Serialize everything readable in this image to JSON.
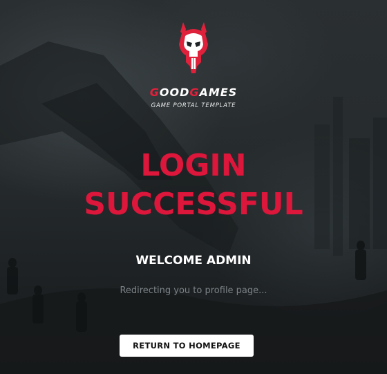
{
  "brand": {
    "name_first_letter": "G",
    "name_rest_1": "OOD",
    "name_second_letter": "G",
    "name_rest_2": "AMES",
    "tagline": "GAME PORTAL TEMPLATE",
    "logo_icon": "skull-icon"
  },
  "main": {
    "title_line1": "LOGIN",
    "title_line2": "SUCCESSFUL",
    "welcome": "WELCOME ADMIN",
    "redirect_text": "Redirecting you to profile page...",
    "return_button_label": "RETURN TO HOMEPAGE"
  },
  "colors": {
    "accent": "#dd163b",
    "background": "#232829",
    "button_bg": "#ffffff",
    "muted_text": "#7b8387"
  }
}
